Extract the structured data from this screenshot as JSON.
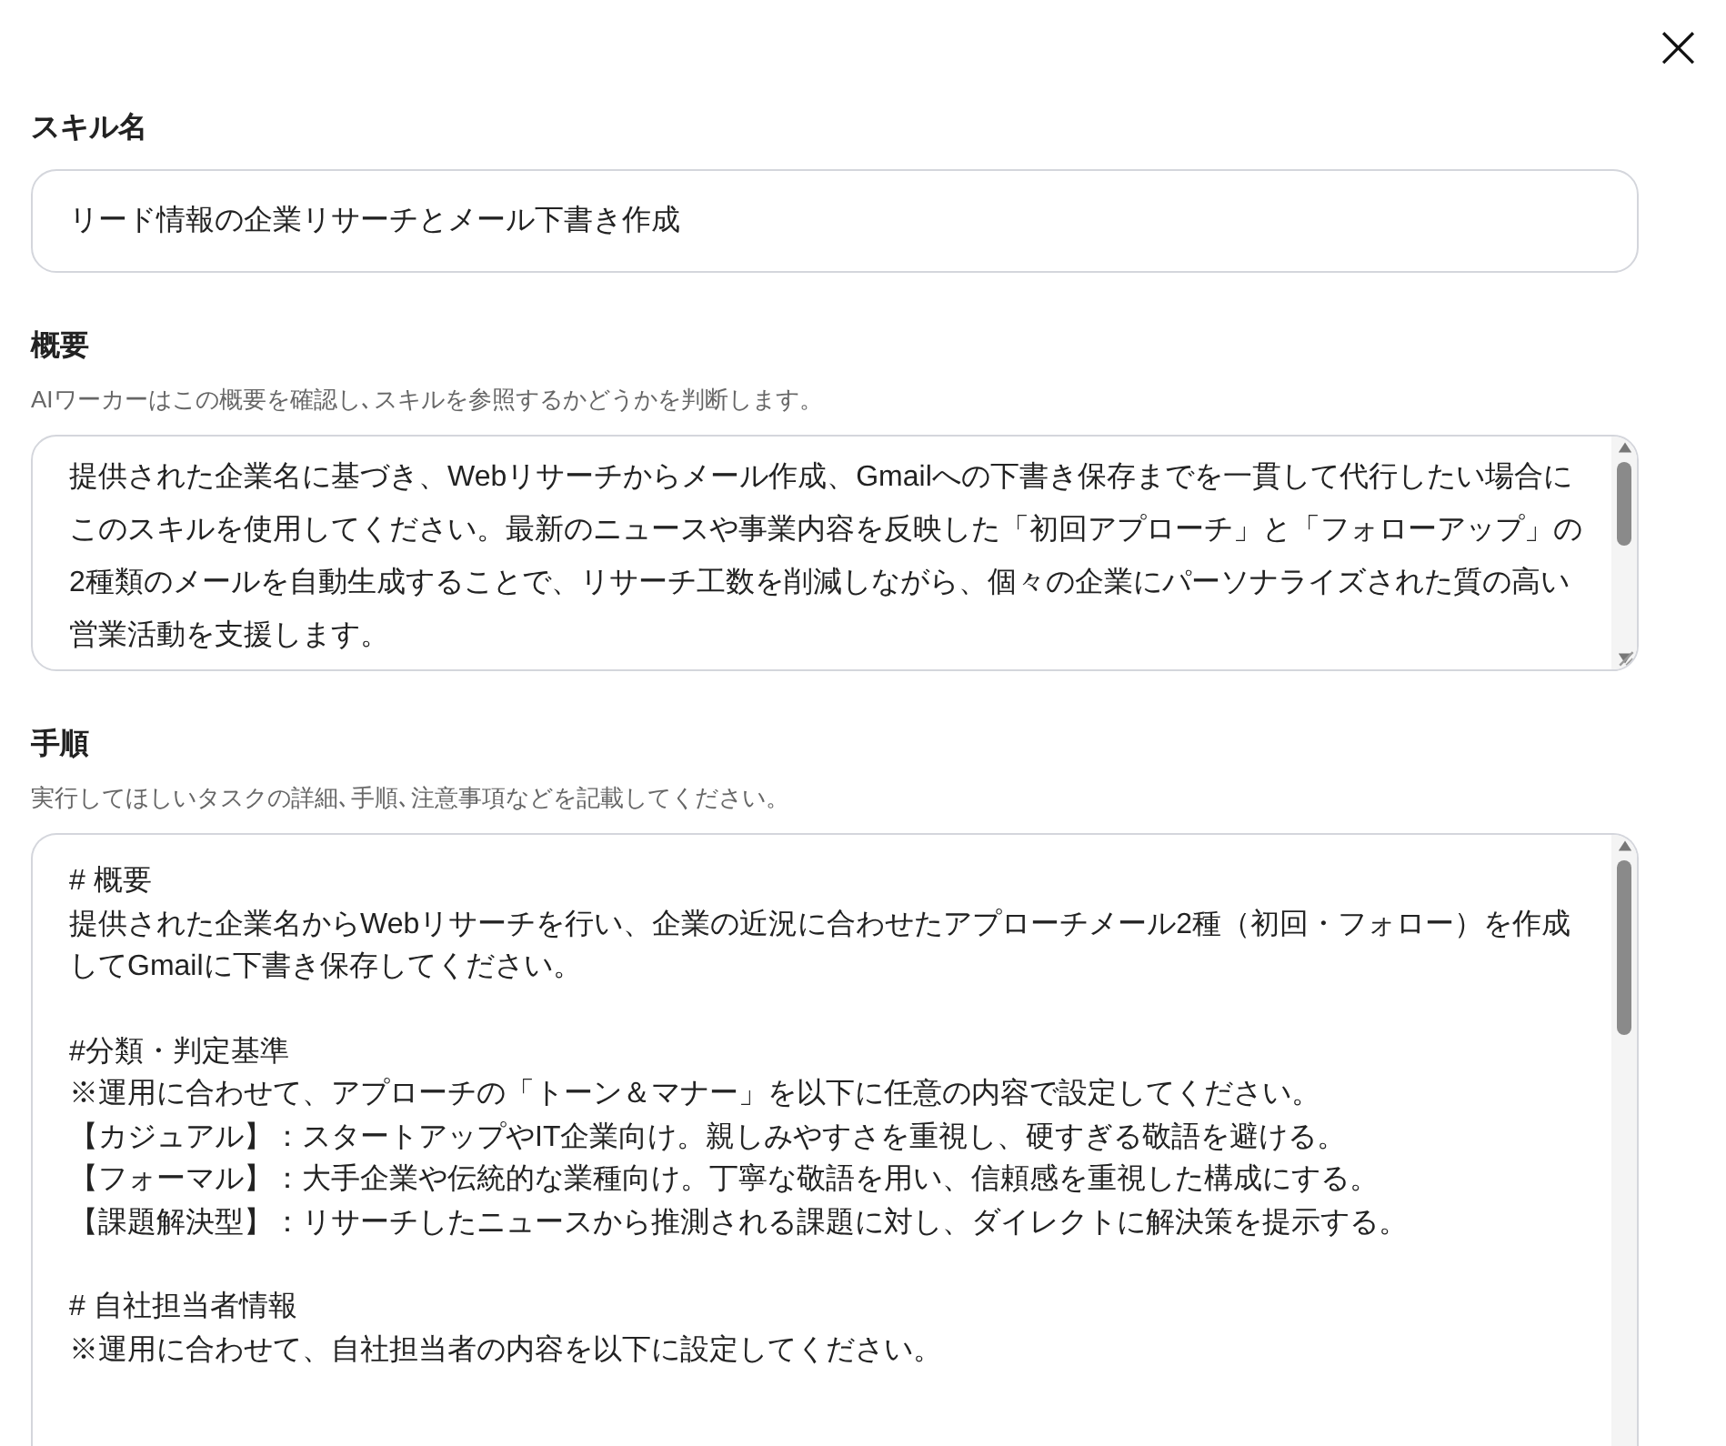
{
  "close_label": "×",
  "skill_name": {
    "label": "スキル名",
    "value": "リード情報の企業リサーチとメール下書き作成"
  },
  "summary": {
    "label": "概要",
    "hint": "AIワーカーはこの概要を確認し､スキルを参照するかどうかを判断します。",
    "value": "提供された企業名に基づき、Webリサーチからメール作成、Gmailへの下書き保存までを一貫して代行したい場合にこのスキルを使用してください。最新のニュースや事業内容を反映した「初回アプローチ」と「フォローアップ」の2種類のメールを自動生成することで、リサーチ工数を削減しながら、個々の企業にパーソナライズされた質の高い営業活動を支援します。"
  },
  "steps": {
    "label": "手順",
    "hint": "実行してほしいタスクの詳細､手順､注意事項などを記載してください。",
    "sections": [
      {
        "lines": [
          "# 概要",
          "提供された企業名からWebリサーチを行い、企業の近況に合わせたアプローチメール2種（初回・フォロー）を作成してGmailに下書き保存してください。"
        ]
      },
      {
        "lines": [
          "#分類・判定基準",
          "※運用に合わせて、アプローチの「トーン＆マナー」を以下に任意の内容で設定してください。",
          "【カジュアル】：スタートアップやIT企業向け。親しみやすさを重視し、硬すぎる敬語を避ける。",
          "【フォーマル】：大手企業や伝統的な業種向け。丁寧な敬語を用い、信頼感を重視した構成にする。",
          "【課題解決型】：リサーチしたニュースから推測される課題に対し、ダイレクトに解決策を提示する。"
        ]
      },
      {
        "lines": [
          "# 自社担当者情報",
          "※運用に合わせて、自社担当者の内容を以下に設定してください。"
        ]
      }
    ]
  }
}
